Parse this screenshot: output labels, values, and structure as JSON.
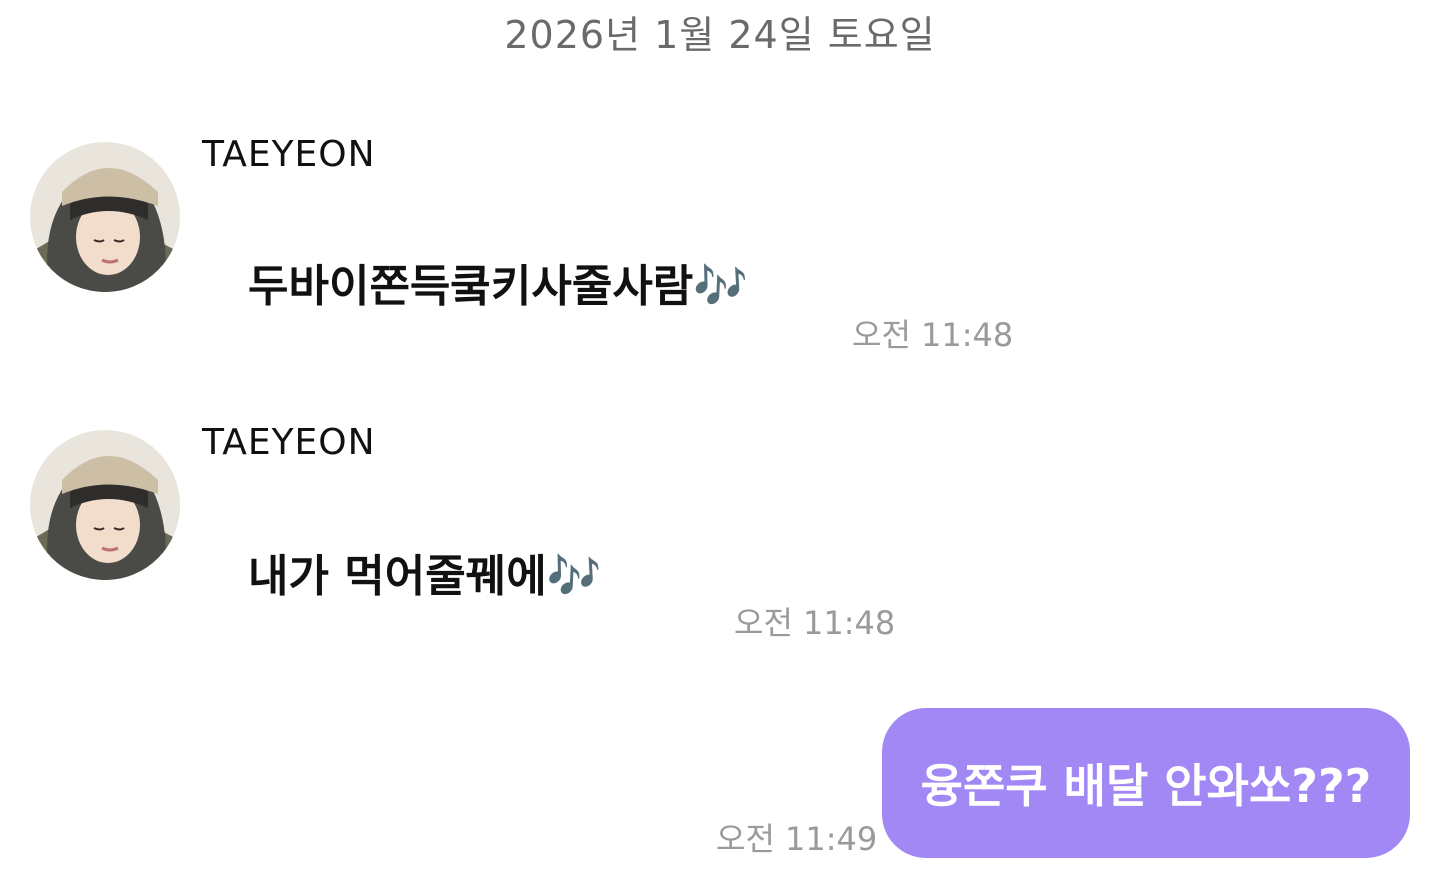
{
  "date_divider": "2026년 1월 24일 토요일",
  "messages": [
    {
      "sender": "TAEYEON",
      "text": "두바이쫀득쿸키사줄사람",
      "emoji": "🎶",
      "time": "오전 11:48"
    },
    {
      "sender": "TAEYEON",
      "text": "내가 먹어줄꿰에",
      "emoji": "🎶",
      "time": "오전 11:48"
    }
  ],
  "outgoing": {
    "text": "융쫀쿠 배달 안와쏘???",
    "time": "오전 11:49"
  },
  "colors": {
    "outgoing_bubble": "#a288f4",
    "timestamp": "#9a9a9a",
    "date_divider": "#6a6a6a"
  },
  "icons": {
    "avatar": "profile-photo-avatar",
    "notes": "musical-notes-emoji"
  }
}
